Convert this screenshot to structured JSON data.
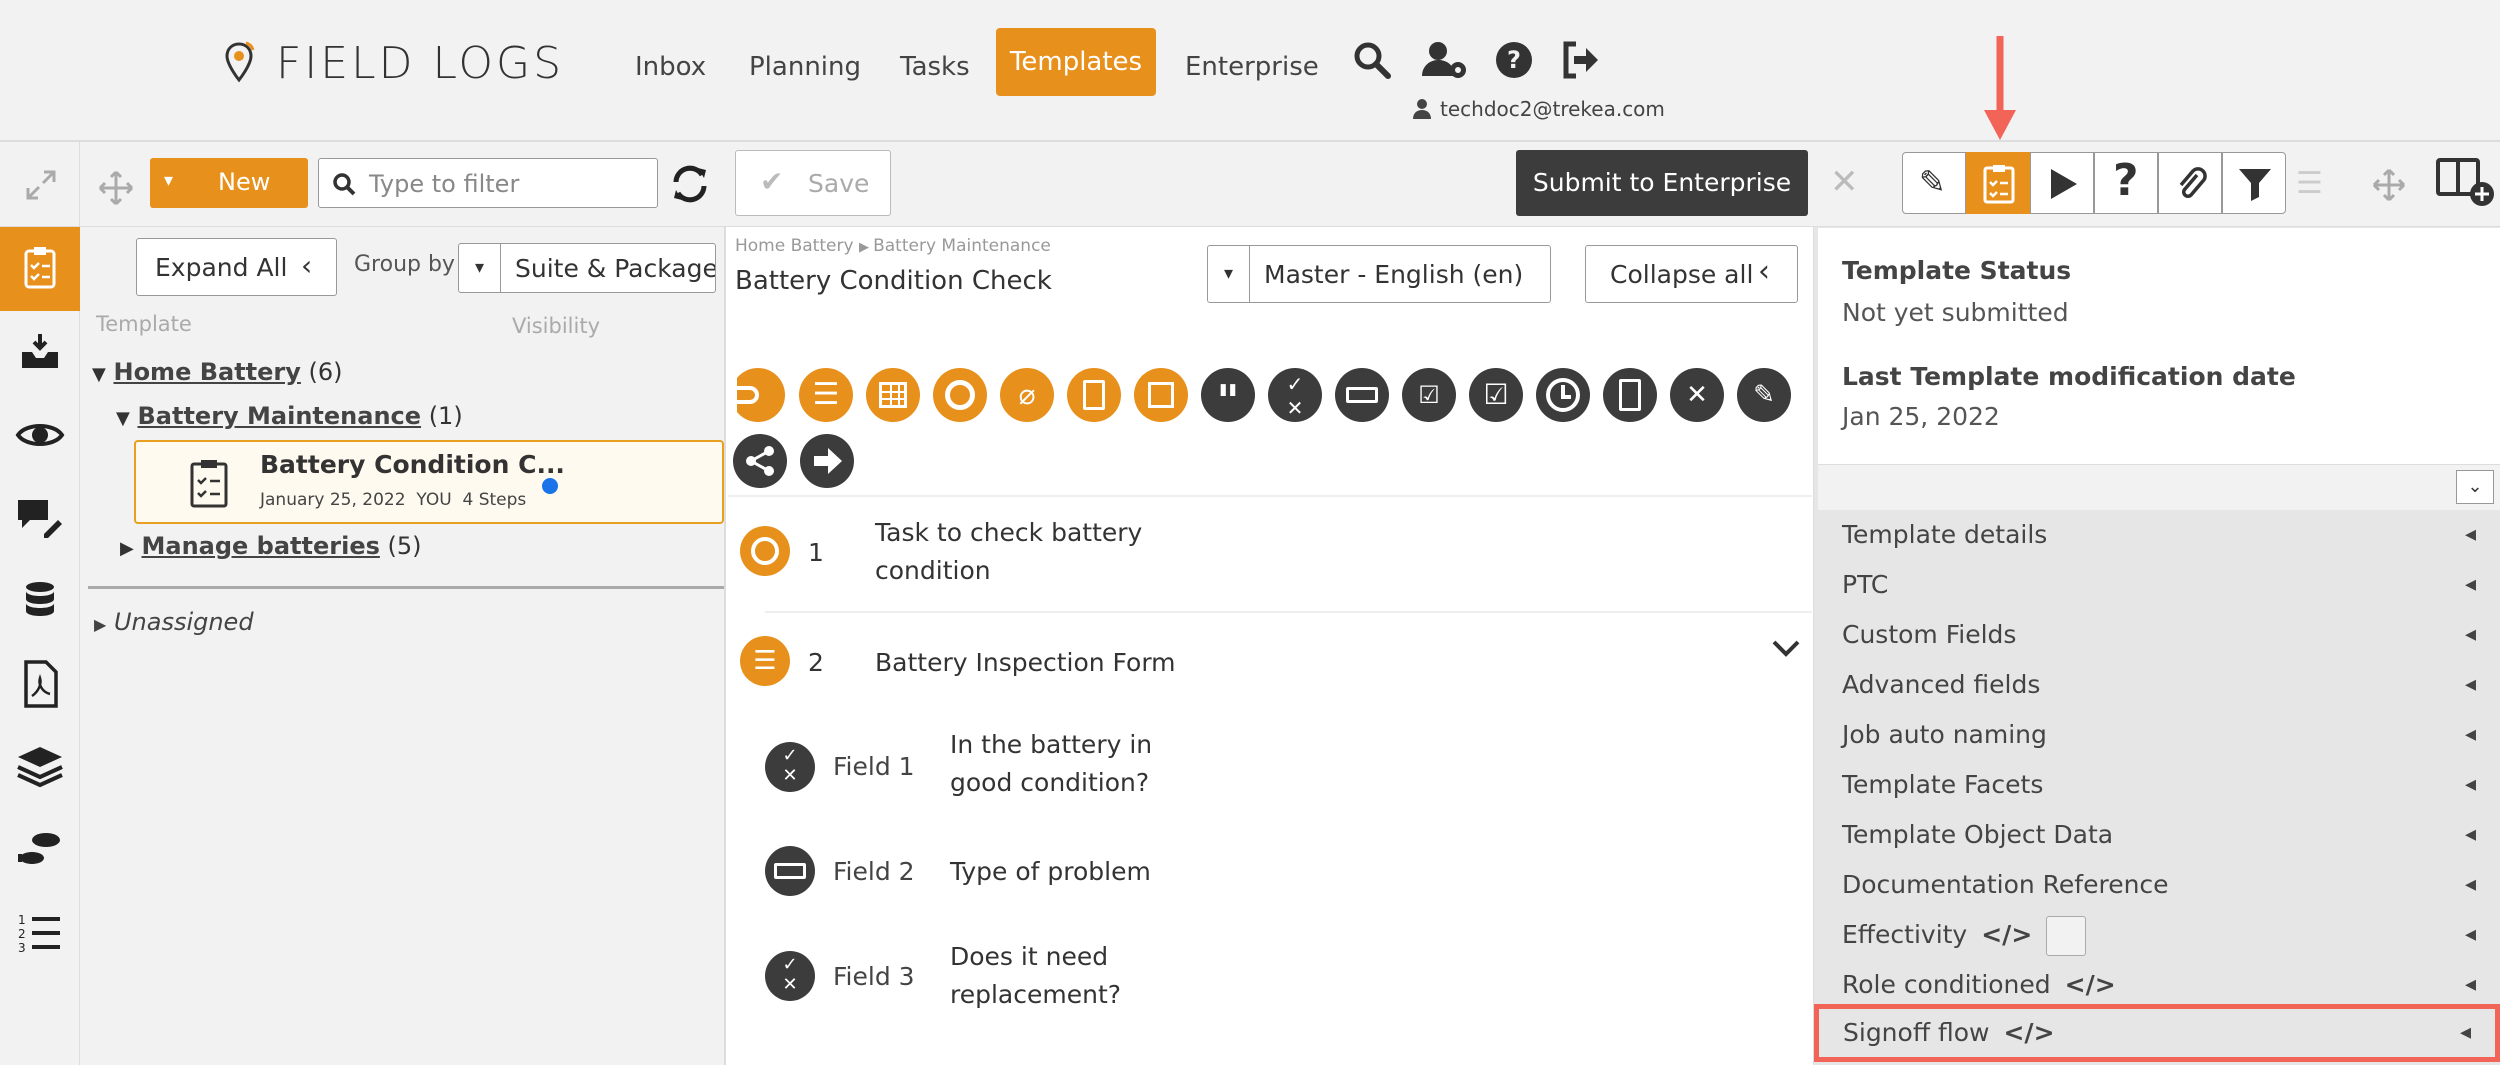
{
  "app": {
    "logo_text": "FIELD LOGS"
  },
  "nav": {
    "items": [
      "Inbox",
      "Planning",
      "Tasks",
      "Templates",
      "Enterprise"
    ],
    "active": "Templates"
  },
  "user": {
    "email": "techdoc2@trekea.com"
  },
  "tree_toolbar": {
    "new_label": "New",
    "filter_placeholder": "Type to filter"
  },
  "tree_controls": {
    "expand_all_label": "Expand All",
    "group_by_label": "Group by",
    "group_by_value": "Suite & Package"
  },
  "tree_headers": {
    "template": "Template",
    "visibility": "Visibility"
  },
  "tree": {
    "home_battery": {
      "label": "Home Battery",
      "count": "(6)"
    },
    "battery_maintenance": {
      "label": "Battery Maintenance",
      "count": "(1)"
    },
    "card": {
      "title": "Battery Condition C...",
      "date": "January 25, 2022",
      "owner": "YOU",
      "steps": "4 Steps"
    },
    "manage_batteries": {
      "label": "Manage batteries",
      "count": "(5)"
    },
    "unassigned": "Unassigned"
  },
  "center": {
    "save_label": "Save",
    "submit_label": "Submit to Enterprise",
    "breadcrumb": [
      "Home Battery",
      "Battery Maintenance"
    ],
    "title": "Battery Condition Check",
    "language_value": "Master - English (en)",
    "collapse_all_label": "Collapse all",
    "steps": [
      {
        "num": "1",
        "text_line1": "Task to check battery",
        "text_line2": "condition"
      },
      {
        "num": "2",
        "text_line1": "Battery Inspection Form",
        "text_line2": ""
      }
    ],
    "fields": [
      {
        "label": "Field 1",
        "text_line1": "In the battery in",
        "text_line2": "good condition?"
      },
      {
        "label": "Field 2",
        "text_line1": "Type of problem",
        "text_line2": ""
      },
      {
        "label": "Field 3",
        "text_line1": "Does it need",
        "text_line2": "replacement?"
      }
    ]
  },
  "right": {
    "status_heading": "Template Status",
    "status_value": "Not yet submitted",
    "mod_heading": "Last Template modification date",
    "mod_value": "Jan 25, 2022",
    "sections": [
      "Template details",
      "PTC",
      "Custom Fields",
      "Advanced fields",
      "Job auto naming",
      "Template Facets",
      "Template Object Data",
      "Documentation Reference",
      "Effectivity",
      "Role conditioned",
      "Signoff flow"
    ]
  },
  "colors": {
    "accent": "#e8901c",
    "dark": "#3c3c3c",
    "highlight": "#f26457",
    "dot": "#1a73e8"
  }
}
